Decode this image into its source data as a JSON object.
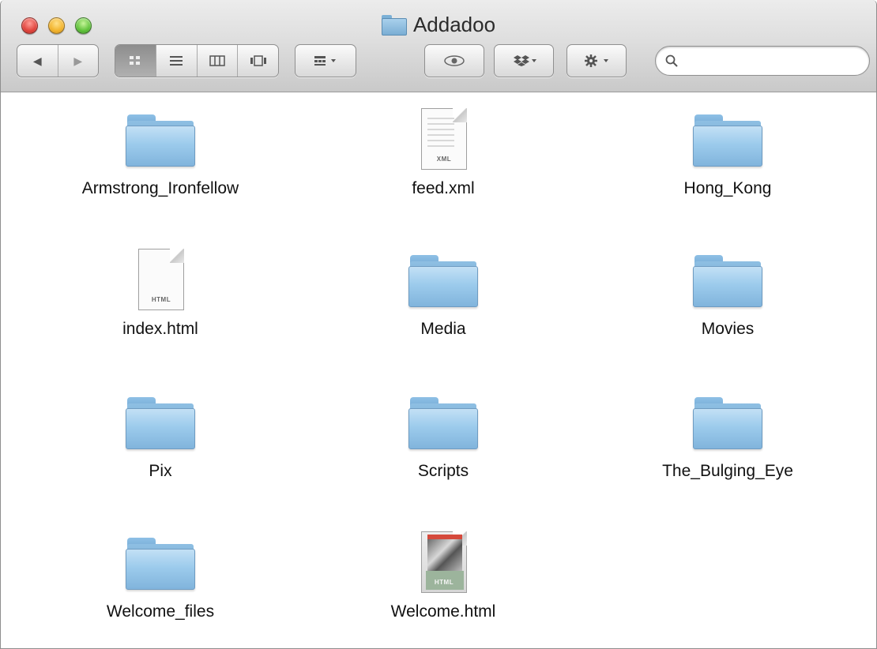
{
  "window": {
    "title": "Addadoo"
  },
  "toolbar": {
    "back_icon": "◀",
    "forward_icon": "▶",
    "view_icons": [
      "icon-view-icon",
      "list-view-icon",
      "column-view-icon",
      "coverflow-view-icon"
    ],
    "arrange_icon": "arrange-icon",
    "quicklook_icon": "eye-icon",
    "dropbox_icon": "dropbox-icon",
    "action_icon": "gear-icon",
    "search_value": "",
    "search_placeholder": ""
  },
  "items": [
    {
      "name": "Armstrong_Ironfellow",
      "kind": "folder"
    },
    {
      "name": "feed.xml",
      "kind": "xml",
      "ext": "XML"
    },
    {
      "name": "Hong_Kong",
      "kind": "folder"
    },
    {
      "name": "index.html",
      "kind": "html",
      "ext": "HTML"
    },
    {
      "name": "Media",
      "kind": "folder"
    },
    {
      "name": "Movies",
      "kind": "folder"
    },
    {
      "name": "Pix",
      "kind": "folder"
    },
    {
      "name": "Scripts",
      "kind": "folder"
    },
    {
      "name": "The_Bulging_Eye",
      "kind": "folder"
    },
    {
      "name": "Welcome_files",
      "kind": "folder"
    },
    {
      "name": "Welcome.html",
      "kind": "html-thumb",
      "ext": "HTML"
    }
  ],
  "colors": {
    "folder": "#9ccbec",
    "titlebar": "#dedede"
  }
}
